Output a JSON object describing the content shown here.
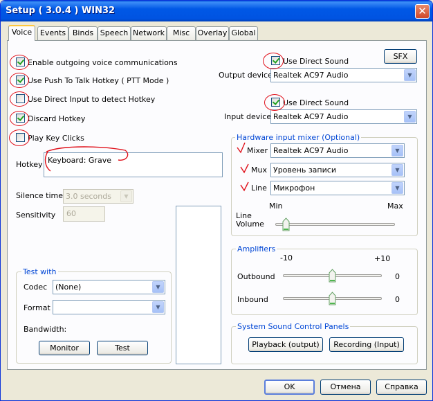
{
  "window": {
    "title": "Setup ( 3.0.4 ) WIN32",
    "close_glyph": "✕"
  },
  "tabs": [
    {
      "label": "Voice",
      "active": true
    },
    {
      "label": "Events"
    },
    {
      "label": "Binds"
    },
    {
      "label": "Speech"
    },
    {
      "label": "Network"
    },
    {
      "label": "Misc"
    },
    {
      "label": "Overlay"
    },
    {
      "label": "Global"
    }
  ],
  "voice": {
    "enable_outgoing": {
      "label": "Enable outgoing voice communications",
      "checked": true
    },
    "push_to_talk": {
      "label": "Use Push To Talk Hotkey ( PTT Mode )",
      "checked": true
    },
    "direct_input": {
      "label": "Use Direct Input to detect Hotkey",
      "checked": false
    },
    "discard_hotkey": {
      "label": "Discard Hotkey",
      "checked": true
    },
    "play_key_clicks": {
      "label": "Play Key Clicks",
      "checked": false
    },
    "hotkey_label": "Hotkey",
    "hotkey_value": "Keyboard:  Grave",
    "silence_label": "Silence time",
    "silence_value": "3.0 seconds",
    "sensitivity_label": "Sensitivity",
    "sensitivity_value": "60"
  },
  "output": {
    "use_direct_sound": {
      "label": "Use Direct Sound",
      "checked": true
    },
    "device_label": "Output device",
    "device_value": "Realtek AC97 Audio",
    "sfx_label": "SFX"
  },
  "input": {
    "use_direct_sound": {
      "label": "Use Direct Sound",
      "checked": true
    },
    "device_label": "Input device",
    "device_value": "Realtek AC97 Audio"
  },
  "mixer": {
    "title": "Hardware input mixer (Optional)",
    "mixer_label": "Mixer",
    "mixer_value": "Realtek AC97 Audio",
    "mux_label": "Mux",
    "mux_value": "Уровень записи",
    "line_label": "Line",
    "line_value": "Микрофон",
    "min_label": "Min",
    "max_label": "Max",
    "line_volume_label_1": "Line",
    "line_volume_label_2": "Volume",
    "line_volume_fraction": 0.05
  },
  "amplifiers": {
    "title": "Amplifiers",
    "min_label": "-10",
    "max_label": "+10",
    "outbound_label": "Outbound",
    "outbound_value": "0",
    "inbound_label": "Inbound",
    "inbound_value": "0",
    "range": [
      -10,
      10
    ],
    "outbound": 0,
    "inbound": 0
  },
  "sound_panels": {
    "title": "System Sound Control Panels",
    "playback_label": "Playback (output)",
    "recording_label": "Recording (Input)"
  },
  "test_with": {
    "title": "Test with",
    "codec_label": "Codec",
    "codec_value": "(None)",
    "format_label": "Format",
    "format_value": "",
    "bandwidth_label": "Bandwidth:",
    "monitor_label": "Monitor",
    "test_label": "Test"
  },
  "footer": {
    "ok_label": "OK",
    "cancel_label": "Отмена",
    "help_label": "Справка"
  },
  "colors": {
    "accent": "#0046D5",
    "annotation": "#E0101A",
    "face": "#ECE9D8"
  }
}
